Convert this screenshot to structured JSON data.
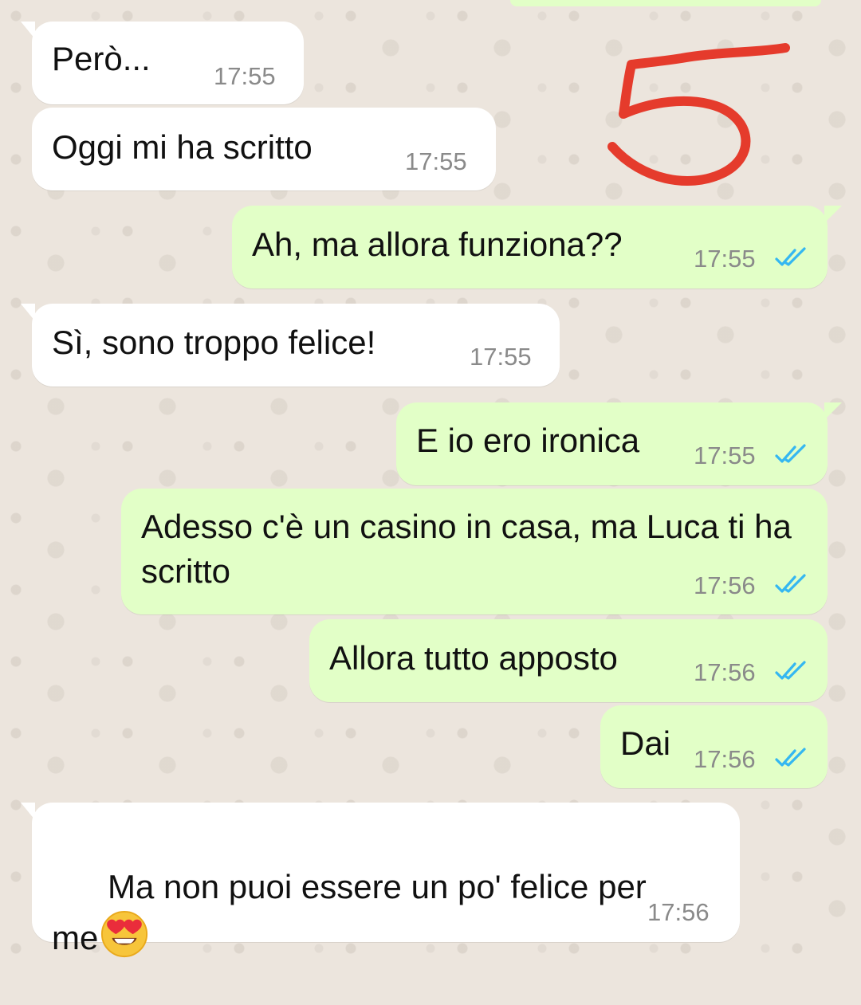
{
  "chat": {
    "messages": [
      {
        "text": "Però...",
        "time": "17:55"
      },
      {
        "text": "Oggi mi ha scritto",
        "time": "17:55"
      },
      {
        "text": "Ah, ma allora funziona??",
        "time": "17:55"
      },
      {
        "text": "Sì, sono troppo felice!",
        "time": "17:55"
      },
      {
        "text": "E io ero ironica",
        "time": "17:55"
      },
      {
        "text": "Adesso c'è un casino in casa, ma Luca ti ha scritto",
        "time": "17:56"
      },
      {
        "text": "Allora tutto apposto",
        "time": "17:56"
      },
      {
        "text": "Dai",
        "time": "17:56"
      },
      {
        "text": "Ma non puoi essere un po' felice per me",
        "time": "17:56"
      }
    ],
    "annotation_text": "5"
  },
  "icons": {
    "read_receipt": "double-check-icon",
    "emoji": "heart-eyes-emoji-icon"
  },
  "colors": {
    "background": "#ece5dd",
    "incoming_bubble": "#ffffff",
    "outgoing_bubble": "#e2ffc7",
    "timestamp": "#8a8a8a",
    "read_ticks": "#34b7f1",
    "annotation": "#e53b2c"
  }
}
